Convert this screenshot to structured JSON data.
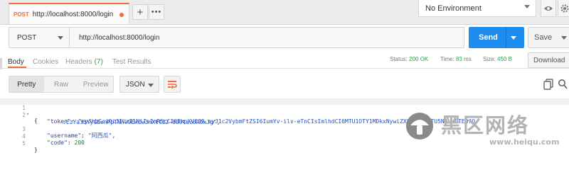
{
  "tab": {
    "method": "POST",
    "url": "http://localhost:8000/login"
  },
  "environment": {
    "label": "No Environment"
  },
  "request": {
    "method": "POST",
    "url": "http://localhost:8000/login"
  },
  "buttons": {
    "send": "Send",
    "save": "Save",
    "download": "Download"
  },
  "response_tabs": [
    {
      "label": "Body",
      "active": true
    },
    {
      "label": "Cookies"
    },
    {
      "label": "Headers",
      "count": "(7)"
    },
    {
      "label": "Test Results"
    }
  ],
  "status": {
    "status_label": "Status:",
    "status_value": "200 OK",
    "time_label": "Time:",
    "time_value": "83 ms",
    "size_label": "Size:",
    "size_value": "450 B"
  },
  "viewer": {
    "modes": [
      "Pretty",
      "Raw",
      "Preview"
    ],
    "format": "JSON"
  },
  "code": {
    "line_numbers": [
      "1",
      "2",
      "",
      "3",
      "4",
      "5"
    ],
    "open_brace": "{",
    "token_key": "\"token\"",
    "token_value_1": "\"eyJhbGciOiJIUzI1NiIsInR5cCI6IkpXVCJ9.eyJ1c2VybmFtZSI6IumYv-ilv-eTnCIsImlhdCI6MTU1OTY1MDkxNywiZXhwIjoxNTU5NjUwOTE0fQ",
    "token_value_2": ".EzYa33YyGEvnPpTNhv9ExEv3nXttI2-009tsoUR0xJg\"",
    "username_key": "\"username\"",
    "username_value": "\"阿西瓜\"",
    "code_key": "\"code\"",
    "code_value": "200",
    "close_brace": "}"
  },
  "watermark": {
    "title": "黑区网络",
    "url": "www.heiqu.com"
  },
  "colors": {
    "accent": "#f26b3a",
    "send": "#1f8cf0",
    "ok": "#2ea44f"
  }
}
